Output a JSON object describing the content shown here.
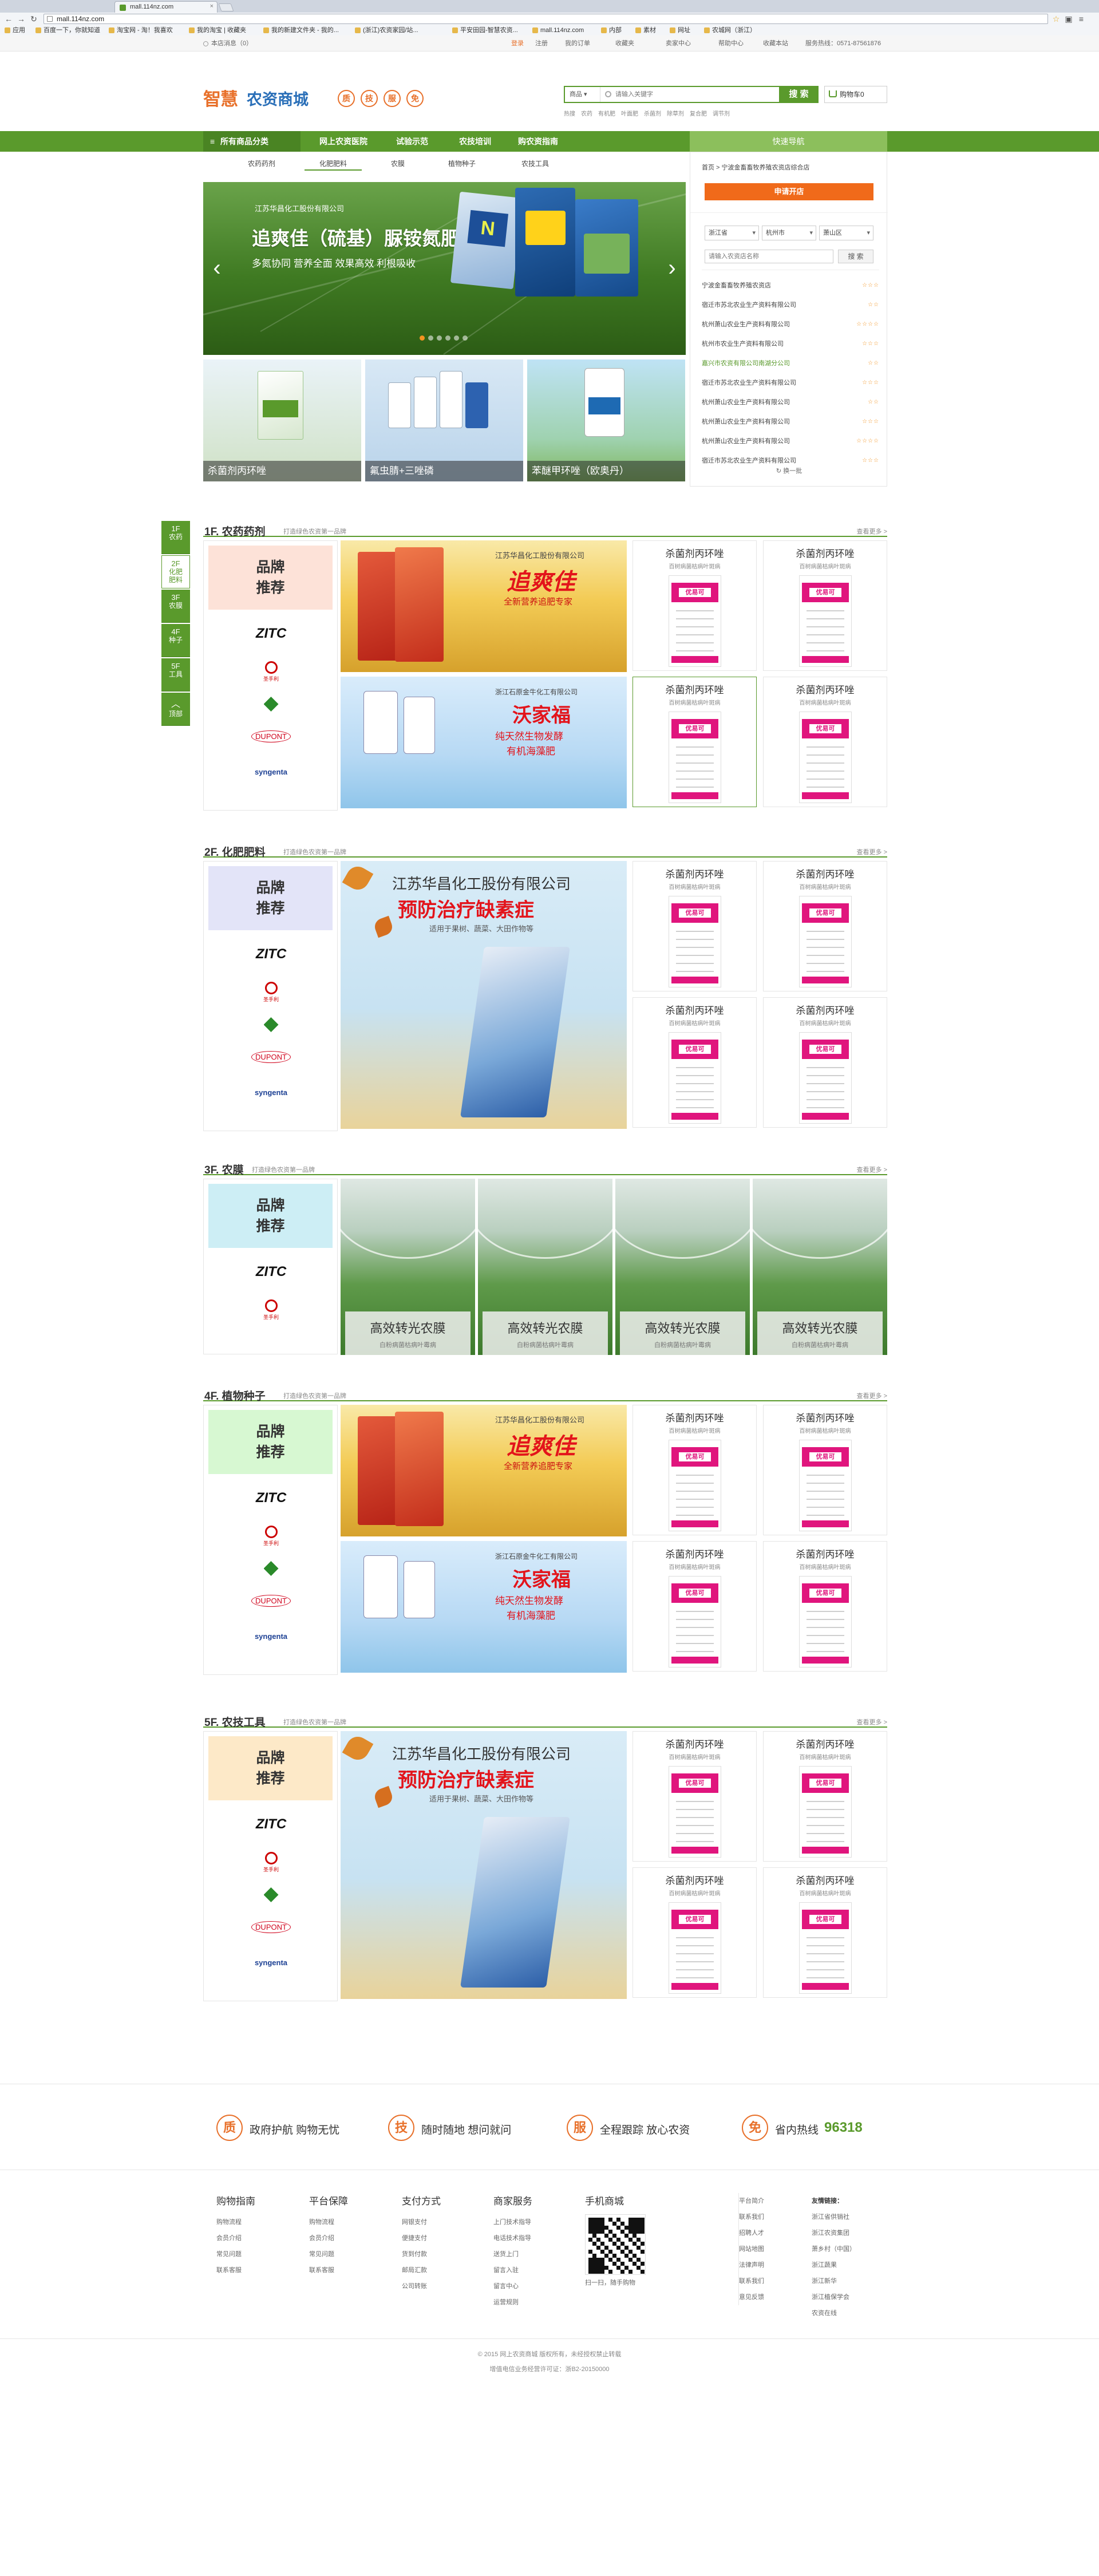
{
  "browser": {
    "tab_title": "mall.114nz.com",
    "url": "mall.114nz.com",
    "bookmarks": [
      "应用",
      "百度一下，你就知道",
      "淘宝网 - 淘！我喜欢",
      "我的淘宝 | 收藏夹",
      "我的新建文件夹 - 我的...",
      "(浙江)农资家园/站...",
      "平安田园-智慧农资...",
      "mall.114nz.com",
      "内部",
      "素材",
      "网址",
      "农城网（浙江）"
    ]
  },
  "topbar": {
    "welcome": "本店消息（0）",
    "login": "登录",
    "register": "注册",
    "my_account": "我的订单",
    "collect": "收藏夹",
    "seller_center": "卖家中心",
    "help": "帮助中心",
    "site_nav": "收藏本站",
    "service": "服务热线：0571-87561876"
  },
  "header": {
    "logo_main": "智慧",
    "logo_sub": "农资商城",
    "badges": [
      "质",
      "技",
      "服",
      "免"
    ],
    "search_select": "商品",
    "search_placeholder": "请输入关键字",
    "search_button": "搜 索",
    "cart_label": "购物车0",
    "hot_words": [
      "热搜",
      "农药",
      "有机肥",
      "叶面肥",
      "杀菌剂",
      "除草剂",
      "复合肥",
      "调节剂"
    ]
  },
  "nav": {
    "all": "所有商品分类",
    "items": [
      "网上农资医院",
      "试验示范",
      "农技培训",
      "购农资指南"
    ],
    "quick": "快速导航"
  },
  "subtabs": [
    "农药药剂",
    "化肥肥料",
    "农膜",
    "植物种子",
    "农技工具"
  ],
  "banner": {
    "company": "江苏华昌化工股份有限公司",
    "title": "追爽佳（硫基）脲铵氮肥",
    "subtitle": "多氮协同 营养全面 效果高效 利根吸收"
  },
  "thumbs": [
    {
      "caption": "杀菌剂丙环唑"
    },
    {
      "caption": "氟虫腈+三唑磷"
    },
    {
      "caption": "苯醚甲环唑（欧奥丹）"
    }
  ],
  "sidebar": {
    "crumb": "首页 > 宁波金畜畜牧养殖农资店综合店",
    "apply_btn": "申请开店",
    "province": "浙江省",
    "city": "杭州市",
    "district": "萧山区",
    "shop_placeholder": "请输入农资店名称",
    "shop_search": "搜 索",
    "shops": [
      {
        "name": "宁波金畜畜牧养殖农资店",
        "stars": "☆☆☆"
      },
      {
        "name": "宿迁市苏北农业生产资料有限公司",
        "stars": "☆☆"
      },
      {
        "name": "杭州萧山农业生产资料有限公司",
        "stars": "☆☆☆☆"
      },
      {
        "name": "杭州市农业生产资料有限公司",
        "stars": "☆☆☆"
      },
      {
        "name": "嘉兴市农资有限公司南湖分公司",
        "stars": "☆☆"
      },
      {
        "name": "宿迁市苏北农业生产资料有限公司",
        "stars": "☆☆☆"
      },
      {
        "name": "杭州萧山农业生产资料有限公司",
        "stars": "☆☆"
      },
      {
        "name": "杭州萧山农业生产资料有限公司",
        "stars": "☆☆☆"
      },
      {
        "name": "杭州萧山农业生产资料有限公司",
        "stars": "☆☆☆☆"
      },
      {
        "name": "宿迁市苏北农业生产资料有限公司",
        "stars": "☆☆☆"
      }
    ],
    "refresh": "换一批"
  },
  "floor_nav": [
    {
      "n": "1F",
      "l": "农药"
    },
    {
      "n": "2F",
      "l": "化肥\n肥料"
    },
    {
      "n": "3F",
      "l": "农膜"
    },
    {
      "n": "4F",
      "l": "种子"
    },
    {
      "n": "5F",
      "l": "工具"
    },
    {
      "n": "",
      "l": "顶部"
    }
  ],
  "brand_label": "品牌\n推荐",
  "brands": [
    "ZITC",
    "圣手利",
    "M",
    "DUPONT",
    "syngenta"
  ],
  "floors": [
    {
      "title": "1F. 农药药剂",
      "sub": "打造绿色农资第一品牌",
      "more": "查看更多 >"
    },
    {
      "title": "2F. 化肥肥料",
      "sub": "打造绿色农资第一品牌",
      "more": "查看更多 >"
    },
    {
      "title": "3F. 农膜",
      "sub": "打造绿色农资第一品牌",
      "more": "查看更多 >"
    },
    {
      "title": "4F. 植物种子",
      "sub": "打造绿色农资第一品牌",
      "more": "查看更多 >"
    },
    {
      "title": "5F. 农技工具",
      "sub": "打造绿色农资第一品牌",
      "more": "查看更多 >"
    }
  ],
  "product": {
    "name": "杀菌剂丙环唑",
    "desc": "百树病菌枯病叶斑病",
    "pack": "优易可"
  },
  "ads": {
    "a_company": "江苏华昌化工股份有限公司",
    "a_title": "追爽佳",
    "a_sub": "全新营养追肥专家",
    "b_company": "浙江石原金牛化工有限公司",
    "b_title": "沃家福",
    "b_sub1": "纯天然生物发酵",
    "b_sub2": "有机海藻肥",
    "c_company": "江苏华昌化工股份有限公司",
    "c_title": "预防治疗缺素症",
    "c_sub": "适用于果树、蔬菜、大田作物等"
  },
  "film": {
    "title": "高效转光农膜",
    "sub": "白粉病菌枯病叶霉病"
  },
  "service": [
    {
      "icon": "质",
      "text": "政府护航 购物无忧"
    },
    {
      "icon": "技",
      "text": "随时随地 想问就问"
    },
    {
      "icon": "服",
      "text": "全程跟踪 放心农资"
    },
    {
      "icon": "免",
      "text": "省内热线",
      "hot": "96318"
    }
  ],
  "footer_cols": [
    {
      "h": "购物指南",
      "i": [
        "购物流程",
        "会员介绍",
        "常见问题",
        "联系客服"
      ]
    },
    {
      "h": "平台保障",
      "i": [
        "购物流程",
        "会员介绍",
        "常见问题",
        "联系客服"
      ]
    },
    {
      "h": "支付方式",
      "i": [
        "网银支付",
        "便捷支付",
        "货到付款",
        "邮局汇款",
        "公司转账"
      ]
    },
    {
      "h": "商家服务",
      "i": [
        "上门技术指导",
        "电话技术指导",
        "送货上门",
        "留言入驻",
        "留言中心",
        "运营规则"
      ]
    },
    {
      "h": "手机商城",
      "i": [
        "扫一扫，随手购物"
      ]
    }
  ],
  "about": [
    "平台简介",
    "联系我们",
    "招聘人才",
    "网站地图",
    "法律声明",
    "联系我们",
    "意见反馈"
  ],
  "friend": {
    "h": "友情链接：",
    "i": [
      "浙江省供销社",
      "浙江农资集团",
      "萧乡村（中国）",
      "浙江蔬果",
      "浙江新华",
      "浙江植保学会",
      "农资在线"
    ]
  },
  "copyright": [
    "© 2015 网上农资商城 版权所有，未经授权禁止转载",
    "增值电信业务经营许可证：浙B2-20150000"
  ]
}
